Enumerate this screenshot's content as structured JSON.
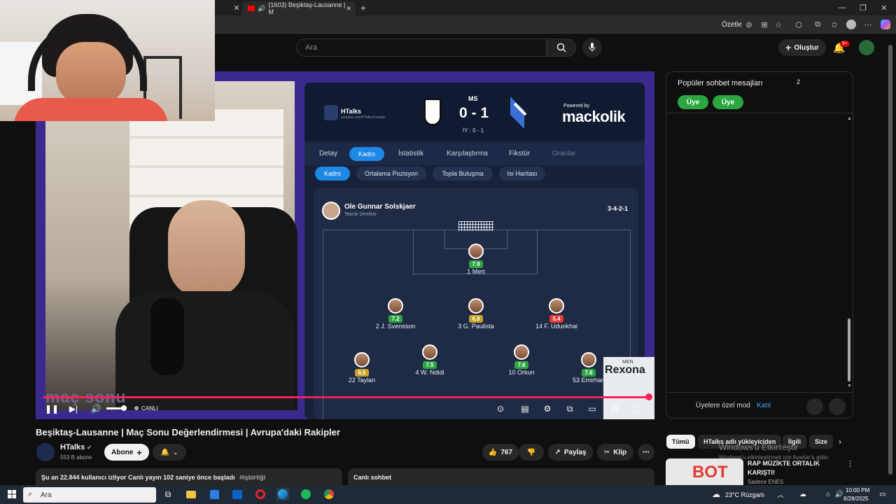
{
  "browser": {
    "tab_title": "(1603) Beşiktaş-Lausanne | M",
    "summarize_label": "Özetle"
  },
  "youtube": {
    "search_placeholder": "Ara",
    "create_label": "Oluştur",
    "notif_badge": "9+"
  },
  "video": {
    "app": {
      "brand": "HTalks",
      "brand_sub": "youtube.com/HTalksYoutube",
      "status": "MS",
      "score": "0 - 1",
      "halftime": "İY : 0 - 1",
      "powered_by": "Powered by",
      "powered_brand": "mackolik",
      "tabs": [
        "Detay",
        "Kadro",
        "İstatistik",
        "Karşılaştırma",
        "Fikstür",
        "Oranlar"
      ],
      "subtabs": [
        "Kadro",
        "Ortalama Pozisyon",
        "Topla Buluşma",
        "Isı Haritası"
      ],
      "coach_name": "Ole Gunnar Solskjaer",
      "coach_role": "Teknik Direktör",
      "formation": "3-4-2-1",
      "players": [
        {
          "name": "1 Mert",
          "rating": "7.9",
          "color": "#2ba640"
        },
        {
          "name": "2 J. Svensson",
          "rating": "7.2",
          "color": "#2ba640"
        },
        {
          "name": "3 G. Paulista",
          "rating": "6.8",
          "color": "#c9a227"
        },
        {
          "name": "14 F. Uduokhai",
          "rating": "5.4",
          "color": "#e53935"
        },
        {
          "name": "22 Taylan",
          "rating": "6.5",
          "color": "#c9a227"
        },
        {
          "name": "4 W. Ndidi",
          "rating": "7.5",
          "color": "#2ba640"
        },
        {
          "name": "10 Orkun",
          "rating": "7.6",
          "color": "#2ba640"
        },
        {
          "name": "53 Emirhan",
          "rating": "7.6",
          "color": "#2ba640"
        }
      ]
    },
    "overlay_text": "maç sonu",
    "live_label": "CANLI",
    "ad_brand_top": "MEN",
    "ad_brand": "Rexona"
  },
  "chat": {
    "title": "Popüler sohbet mesajları",
    "count": "2",
    "member_buttons": [
      "Üye",
      "Üye"
    ],
    "mode_label": "Üyelere özel mod",
    "join_label": "Katıl"
  },
  "below": {
    "title": "Beşiktaş-Lausanne | Maç Sonu Değerlendirmesi | Avrupa'daki Rakipler",
    "channel": "HTalks",
    "subscribers": "553 B abone",
    "subscribe_label": "Abone",
    "likes": "767",
    "share_label": "Paylaş",
    "clip_label": "Klip",
    "watching": "Şu an 22.844 kullanıcı izliyor  Canlı yayın 102 saniye önce başladı",
    "hashtag": "#işbirliği",
    "live_chat": "Canlı sohbet",
    "filter_chips": [
      "Tümü",
      "HTalks adlı yükleyiciden",
      "İlgili",
      "Size"
    ],
    "rec_title": "RAP MÜZİKTE ORTALIK KARIŞTI!",
    "rec_channel": "Sadece ENES",
    "rec_thumb_text": "BOT",
    "activation_title": "Windows'u Etkinleştir",
    "activation_sub": "Windows'u etkinleştirmek için Ayarlar'a gidin."
  },
  "taskbar": {
    "search_placeholder": "Ara",
    "weather": "23°C  Rüzgarlı",
    "time": "10:00 PM",
    "date": "8/28/2025"
  }
}
